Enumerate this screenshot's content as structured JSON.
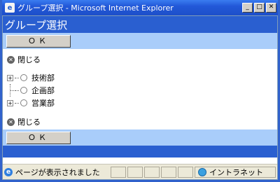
{
  "window": {
    "title": "グループ選択 - Microsoft Internet Explorer",
    "minimize": "_",
    "maximize": "□",
    "close": "✕"
  },
  "page": {
    "header": "グループ選択",
    "ok_label": "ＯＫ",
    "close_label": "閉じる",
    "tree": [
      {
        "label": "技術部",
        "expandable": true
      },
      {
        "label": "企画部",
        "expandable": false
      },
      {
        "label": "営業部",
        "expandable": true
      }
    ]
  },
  "statusbar": {
    "message": "ページが表示されました",
    "zone": "イントラネット"
  },
  "icons": {
    "app": "ie-icon",
    "close_circle": "x-circle-icon",
    "expand": "plus-box-icon"
  }
}
